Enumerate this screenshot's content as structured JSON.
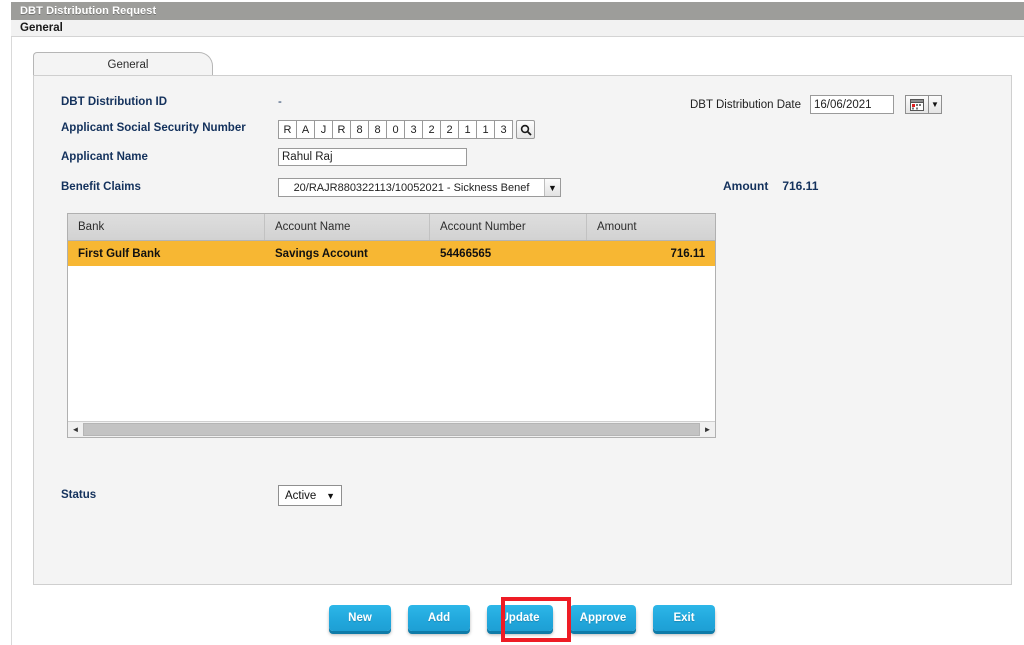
{
  "window": {
    "title": "DBT Distribution Request"
  },
  "menubar": {
    "items": [
      {
        "label": "General"
      }
    ]
  },
  "tabs": [
    {
      "label": "General",
      "active": true
    }
  ],
  "form": {
    "distribution_id": {
      "label": "DBT Distribution ID",
      "value": "-"
    },
    "distribution_date": {
      "label": "DBT Distribution Date",
      "value": "16/06/2021",
      "calendar_icon": "calendar-icon",
      "dropdown_icon": "chevron-down-icon"
    },
    "ssn": {
      "label": "Applicant Social Security Number",
      "characters": [
        "R",
        "A",
        "J",
        "R",
        "8",
        "8",
        "0",
        "3",
        "2",
        "2",
        "1",
        "1",
        "3"
      ],
      "search_icon": "search-icon"
    },
    "applicant_name": {
      "label": "Applicant Name",
      "value": "Rahul Raj",
      "placeholder": ""
    },
    "benefit_claims": {
      "label": "Benefit Claims",
      "selected": "20/RAJR880322113/10052021 - Sickness Benef",
      "arrow_icon": "chevron-down-icon"
    },
    "amount": {
      "label": "Amount",
      "value": "716.11"
    },
    "status": {
      "label": "Status",
      "selected": "Active",
      "arrow_icon": "chevron-down-icon"
    }
  },
  "grid": {
    "columns": [
      "Bank",
      "Account Name",
      "Account Number",
      "Amount"
    ],
    "rows": [
      {
        "bank": "First Gulf Bank",
        "account_name": "Savings Account",
        "account_number": "54466565",
        "amount": "716.11",
        "selected": true
      }
    ],
    "scrollbar": {
      "left_arrow": "triangle-left-icon",
      "right_arrow": "triangle-right-icon"
    }
  },
  "buttons": [
    {
      "label": "New"
    },
    {
      "label": "Add",
      "highlighted": true
    },
    {
      "label": "Update"
    },
    {
      "label": "Approve"
    },
    {
      "label": "Exit"
    }
  ],
  "colors": {
    "titlebar": "#9d9d9a",
    "label_text": "#13315c",
    "row_highlight": "#f7b733",
    "button": "#22a8dd",
    "button_shadow": "#0f7ba8",
    "annotation": "#ee1c25",
    "panel_bg": "#f4f4f4"
  }
}
